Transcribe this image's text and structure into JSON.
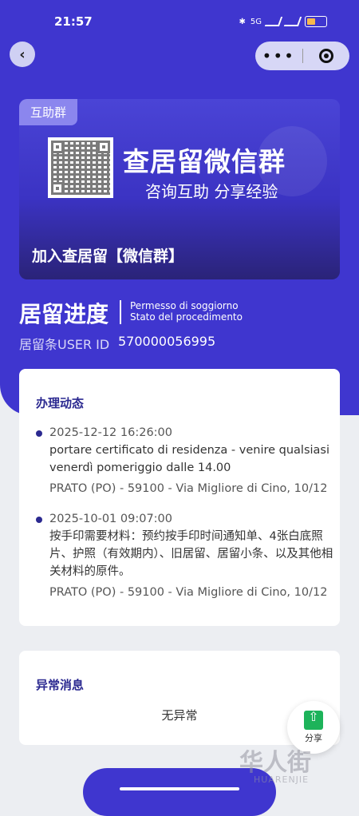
{
  "status_bar": {
    "time": "21:57",
    "network": "5G",
    "battery": "battery"
  },
  "nav": {
    "back_icon": "chevron-left-icon",
    "more_icon": "•••",
    "target_icon": "target-icon"
  },
  "banner": {
    "badge": "互助群",
    "title": "查居留微信群",
    "subtitle": "咨询互助 分享经验",
    "cta": "加入查居留【微信群】"
  },
  "progress": {
    "title": "居留进度",
    "sub_line1": "Permesso di soggiorno",
    "sub_line2": "Stato del procedimento",
    "user_id_label": "居留条USER ID",
    "user_id_value": "570000056995"
  },
  "activity": {
    "title": "办理动态",
    "entries": [
      {
        "date": "2025-12-12 16:26:00",
        "desc": "portare certificato di residenza - venire qualsiasi venerdì pomeriggio dalle 14.00",
        "address": "PRATO (PO) - 59100 - Via Migliore di Cino, 10/12"
      },
      {
        "date": "2025-10-01 09:07:00",
        "desc": "按手印需要材料：预约按手印时间通知单、4张白底照片、护照（有效期内）、旧居留、居留小条、以及其他相关材料的原件。",
        "address": "PRATO (PO) - 59100 - Via Migliore di Cino, 10/12"
      }
    ]
  },
  "anomaly": {
    "title": "异常消息",
    "empty": "无异常"
  },
  "share": {
    "label": "分享"
  },
  "watermark": {
    "main": "华人街",
    "sub": "HUARENJIE"
  },
  "colors": {
    "primary": "#3f36cf",
    "accent_text": "#2b2990",
    "share_green": "#1db35a"
  }
}
